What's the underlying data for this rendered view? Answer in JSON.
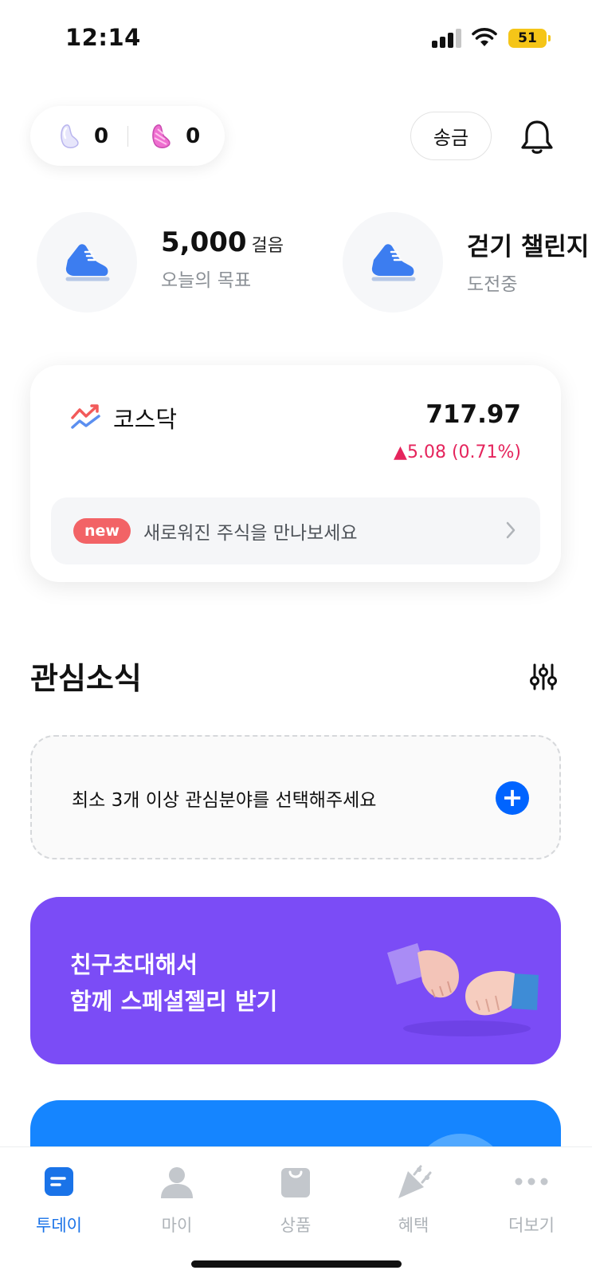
{
  "status_bar": {
    "time": "12:14",
    "battery": "51"
  },
  "header": {
    "jelly_basic_count": "0",
    "jelly_special_count": "0",
    "send_label": "송금"
  },
  "steps": [
    {
      "main": "5,000",
      "unit": "걸음",
      "sub": "오늘의 목표"
    },
    {
      "main": "걷기 챌린지",
      "sub": "도전중"
    }
  ],
  "market": {
    "name": "코스닥",
    "value": "717.97",
    "change": "▲5.08 (0.71%)",
    "change_color": "#e5245c",
    "banner_badge": "new",
    "banner_text": "새로워진 주식을 만나보세요"
  },
  "interests": {
    "title": "관심소식",
    "prompt": "최소 3개 이상 관심분야를 선택해주세요"
  },
  "invite": {
    "line1": "친구초대해서",
    "line2": "함께 스페셜젤리 받기",
    "bg_color": "#7b4cf6"
  },
  "tabs": [
    {
      "label": "투데이",
      "icon": "today-icon",
      "active": true
    },
    {
      "label": "마이",
      "icon": "person-icon",
      "active": false
    },
    {
      "label": "상품",
      "icon": "shopping-bag-icon",
      "active": false
    },
    {
      "label": "혜택",
      "icon": "party-popper-icon",
      "active": false
    },
    {
      "label": "더보기",
      "icon": "more-dots-icon",
      "active": false
    }
  ],
  "colors": {
    "accent": "#1a73e8",
    "primary_button": "#0064ff"
  }
}
